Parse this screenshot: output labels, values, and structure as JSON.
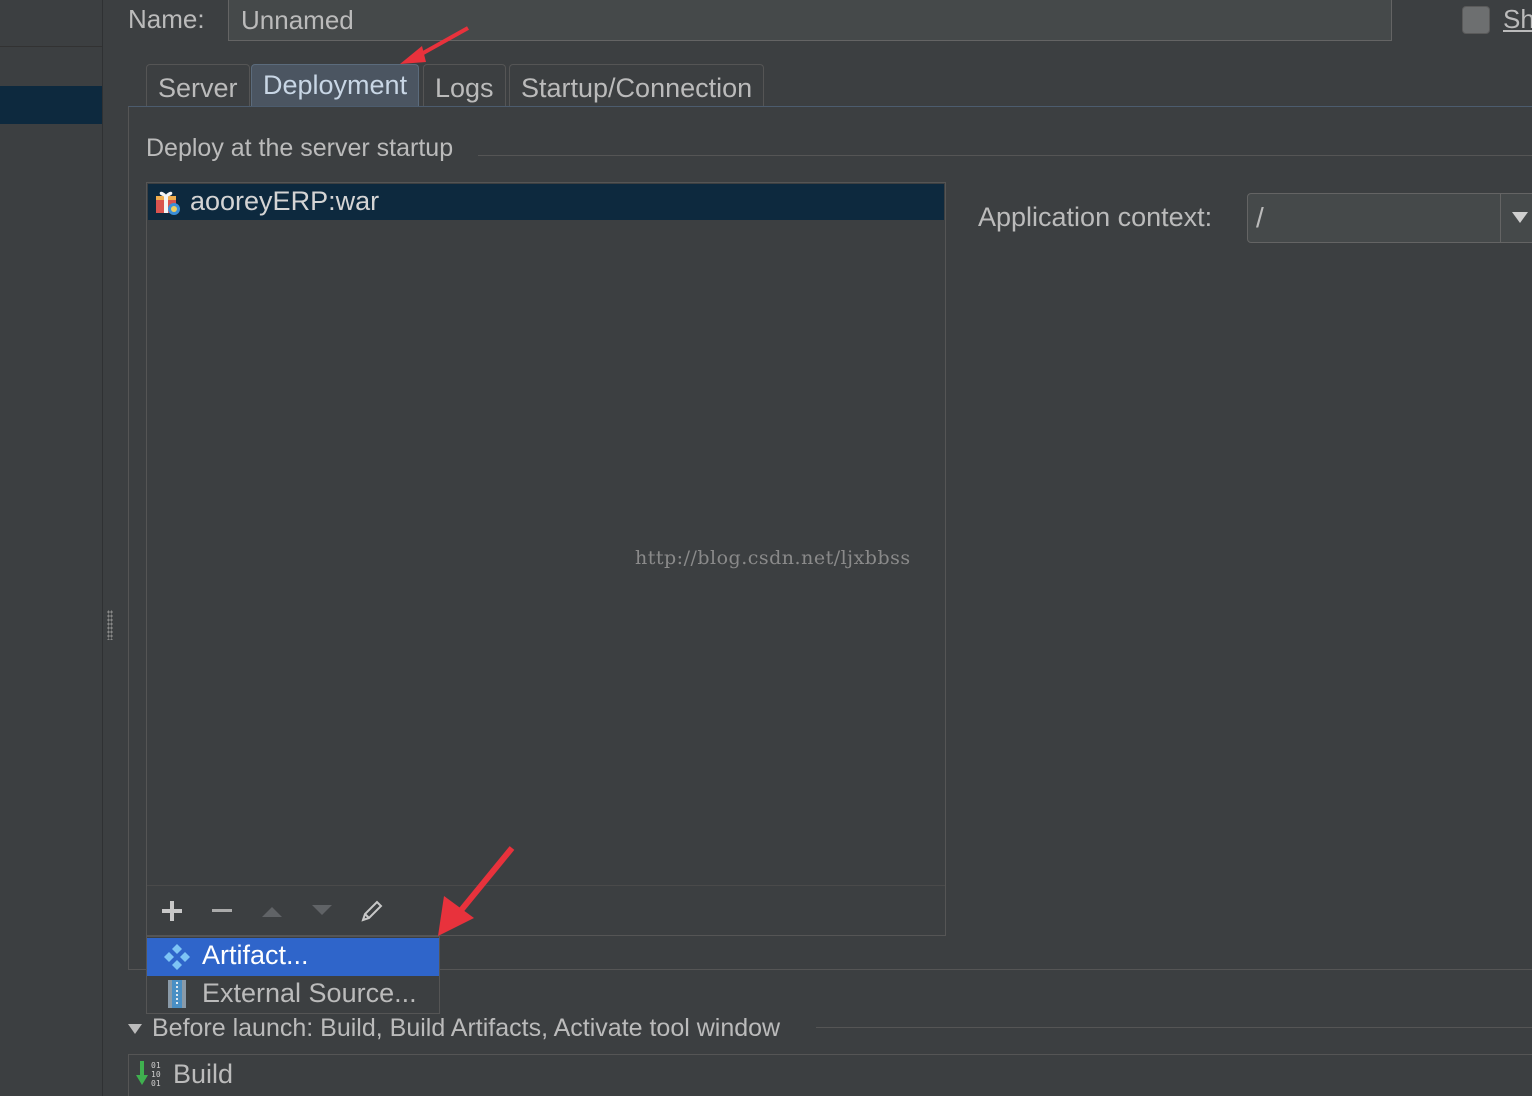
{
  "name_row": {
    "label": "Name:",
    "value": "Unnamed",
    "share_label": "Sh"
  },
  "tabs": [
    {
      "label": "Server",
      "active": false
    },
    {
      "label": "Deployment",
      "active": true
    },
    {
      "label": "Logs",
      "active": false
    },
    {
      "label": "Startup/Connection",
      "active": false
    }
  ],
  "deployment": {
    "section_title": "Deploy at the server startup",
    "items": [
      {
        "label": "aooreyERP:war",
        "icon": "artifact-war-icon",
        "selected": true
      }
    ],
    "watermark": "http://blog.csdn.net/ljxbbss",
    "toolbar": {
      "add_icon": "plus-icon",
      "remove_icon": "minus-icon",
      "up_icon": "move-up-icon",
      "down_icon": "move-down-icon",
      "edit_icon": "pencil-icon"
    }
  },
  "add_popup": {
    "items": [
      {
        "label": "Artifact...",
        "icon": "artifact-icon",
        "selected": true
      },
      {
        "label": "External Source...",
        "icon": "external-source-icon",
        "selected": false
      }
    ]
  },
  "application_context": {
    "label": "Application context:",
    "value": "/"
  },
  "before_launch": {
    "label": "Before launch: Build, Build Artifacts, Activate tool window",
    "tasks": [
      {
        "label": "Build",
        "icon": "build-icon"
      }
    ]
  },
  "colors": {
    "background": "#3c3f41",
    "selection": "#0d293e",
    "popup_selection": "#2f65ca",
    "active_tab": "#4b5561",
    "annotation_arrow": "#e8323c"
  }
}
